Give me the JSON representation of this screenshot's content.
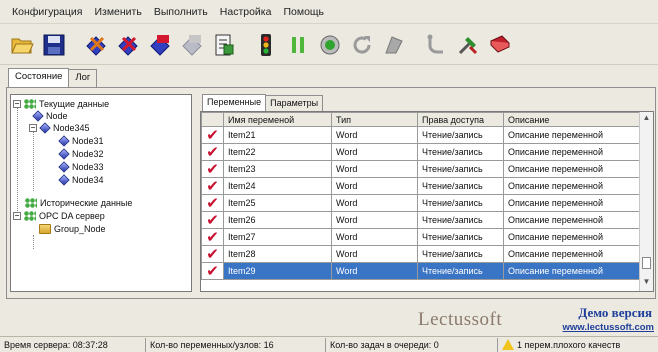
{
  "menu": [
    "Конфигурация",
    "Изменить",
    "Выполнить",
    "Настройка",
    "Помощь"
  ],
  "toolbar_icons": [
    "open-folder-icon",
    "save-icon",
    "add-server-icon",
    "delete-server-icon",
    "add-group-icon",
    "delete-group-icon",
    "properties-icon",
    "traffic-light-icon",
    "pause-icon",
    "record-icon",
    "refresh-icon",
    "clear-icon",
    "find-icon",
    "tools-icon",
    "book-icon"
  ],
  "outer_tabs": {
    "state": "Состояние",
    "log": "Лог"
  },
  "tree": {
    "current_data": "Текущие данные",
    "node": "Node",
    "node345": "Node345",
    "node31": "Node31",
    "node32": "Node32",
    "node33": "Node33",
    "node34": "Node34",
    "historical_data": "Исторические данные",
    "opc_server": "OPC DA сервер",
    "group_node": "Group_Node"
  },
  "inner_tabs": {
    "variables": "Переменные",
    "parameters": "Параметры"
  },
  "table": {
    "columns": [
      "Имя переменой",
      "Тип",
      "Права доступа",
      "Описание"
    ],
    "rows": [
      {
        "name": "Item21",
        "type": "Word",
        "access": "Чтение/запись",
        "desc": "Описание переменной"
      },
      {
        "name": "Item22",
        "type": "Word",
        "access": "Чтение/запись",
        "desc": "Описание переменной"
      },
      {
        "name": "Item23",
        "type": "Word",
        "access": "Чтение/запись",
        "desc": "Описание переменной"
      },
      {
        "name": "Item24",
        "type": "Word",
        "access": "Чтение/запись",
        "desc": "Описание переменной"
      },
      {
        "name": "Item25",
        "type": "Word",
        "access": "Чтение/запись",
        "desc": "Описание переменной"
      },
      {
        "name": "Item26",
        "type": "Word",
        "access": "Чтение/запись",
        "desc": "Описание переменной"
      },
      {
        "name": "Item27",
        "type": "Word",
        "access": "Чтение/запись",
        "desc": "Описание переменной"
      },
      {
        "name": "Item28",
        "type": "Word",
        "access": "Чтение/запись",
        "desc": "Описание переменной"
      },
      {
        "name": "Item29",
        "type": "Word",
        "access": "Чтение/запись",
        "desc": "Описание переменной"
      }
    ],
    "selected_row": 8,
    "check_mark": "✔"
  },
  "branding": {
    "logo": "Lectussoft",
    "demo": "Демо версия",
    "site": "www.lectussoft.com"
  },
  "status": {
    "server_time": "Время сервера: 08:37:28",
    "var_count": "Кол-во переменных/узлов: 16",
    "queue": "Кол-во задач в очереди: 0",
    "bad_quality": "1 перем.плохого качеств"
  },
  "colors": {
    "selection": "#3a74c4",
    "check": "#c8102e",
    "brand_text": "#1e3e9a"
  }
}
